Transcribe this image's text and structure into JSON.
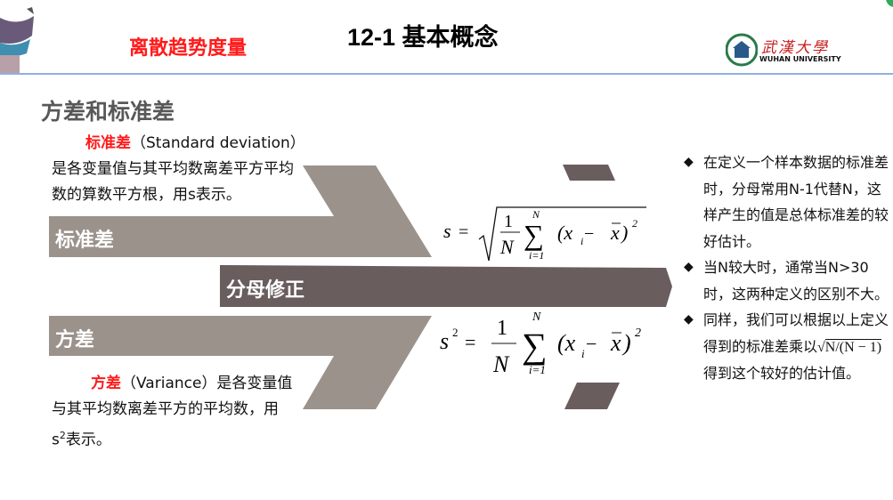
{
  "header": {
    "topic": "离散趋势度量",
    "title": "12-1 基本概念",
    "logo_text": "武漢大學",
    "logo_subtext": "WUHAN UNIVERSITY"
  },
  "section_title": "方差和标准差",
  "std_def": {
    "term": "标准差",
    "english": "（Standard  deviation）",
    "line1": "是各变量值与其平均数离差平方平均",
    "line2": "数的算数平方根，用s表示。"
  },
  "var_def": {
    "term": "方差",
    "english": "（Variance）是各变量值",
    "line1": "与其平均数离差平方的平均数，用",
    "line2_pre": "s",
    "line2_sup": "2",
    "line2_post": "表示。"
  },
  "diagram": {
    "top_label": "标准差",
    "middle_label": "分母修正",
    "bottom_label": "方差",
    "colors": {
      "light": "#9b928c",
      "dark": "#695d5d"
    }
  },
  "formulas": {
    "std": {
      "lhs": "s",
      "eq": "=",
      "num": "1",
      "den": "N",
      "sum_top": "N",
      "sum_bottom": "i=1",
      "body": "(x",
      "sub": "i",
      "minus": " − ",
      "xbar": "x",
      "close": ")",
      "power": "2"
    },
    "var": {
      "lhs": "s",
      "lhs_power": "2",
      "eq": "=",
      "num": "1",
      "den": "N",
      "sum_top": "N",
      "sum_bottom": "i=1",
      "body": "(x",
      "sub": "i",
      "minus": " − ",
      "xbar": "x",
      "close": ")",
      "power": "2"
    }
  },
  "notes": [
    {
      "text": "在定义一个样本数据的标准差时，分母常用N-1代替N，这样产生的值是总体标准差的较好估计。"
    },
    {
      "text": "当N较大时，通常当N>30时，这两种定义的区别不大。"
    },
    {
      "sqrt": "N/(N − 1)",
      "pre": "同样，我们可以根据以上定义得到的标准差乘以",
      "post": "得到这个较好的估计值。"
    }
  ],
  "bullet_icon": "diamond-bullet-icon"
}
